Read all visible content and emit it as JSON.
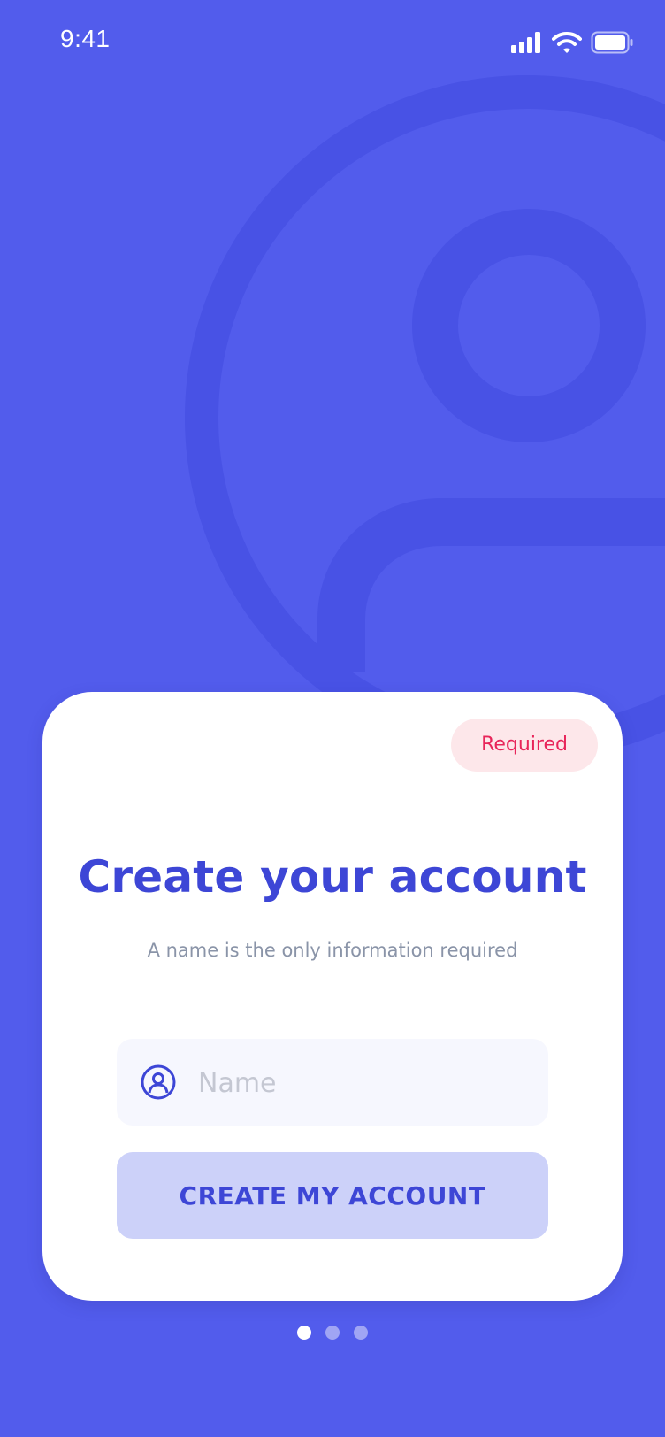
{
  "status_bar": {
    "time": "9:41",
    "icons": [
      "signal-icon",
      "wifi-icon",
      "battery-icon"
    ]
  },
  "card": {
    "badge_label": "Required",
    "title": "Create your account",
    "subtitle": "A name is the only information required",
    "name_field": {
      "placeholder": "Name",
      "value": "",
      "icon": "user-icon"
    },
    "cta_label": "CREATE MY ACCOUNT"
  },
  "pager": {
    "count": 3,
    "active_index": 0
  },
  "colors": {
    "background": "#525CEC",
    "accent": "#3D46D6",
    "badge_bg": "#FDE7EA",
    "badge_text": "#E8255A",
    "button_bg": "#CCD1F9"
  }
}
